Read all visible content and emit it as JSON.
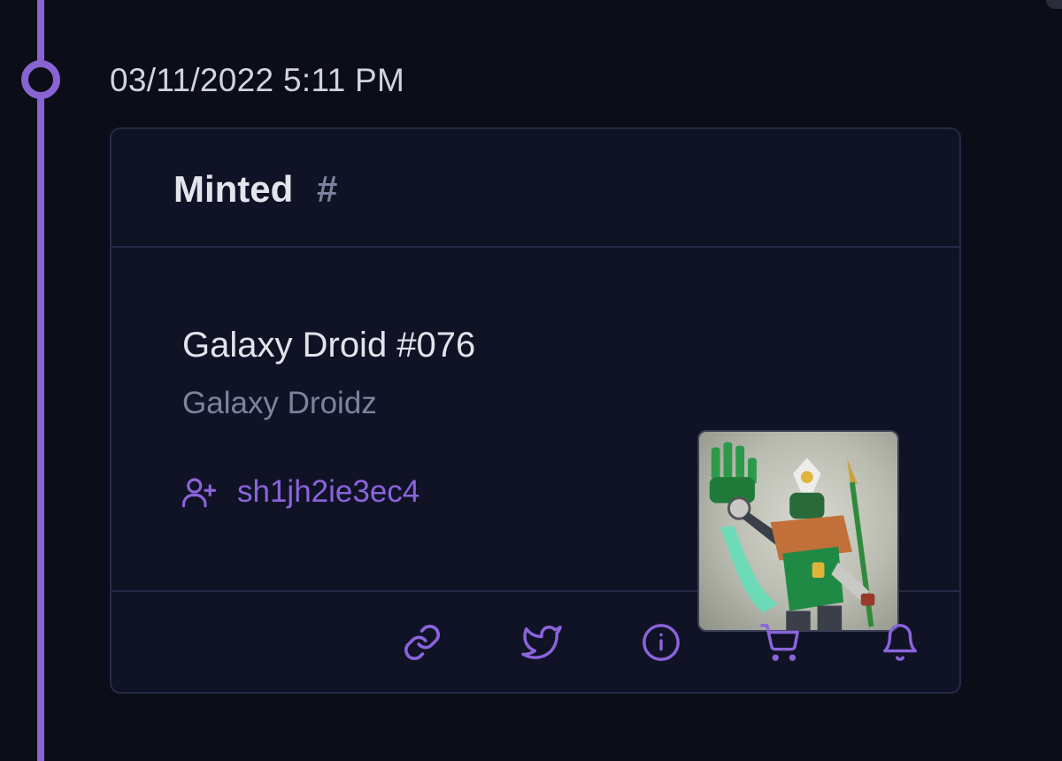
{
  "event": {
    "timestamp": "03/11/2022 5:11 PM",
    "title": "Minted",
    "anchor_symbol": "#"
  },
  "nft": {
    "name": "Galaxy Droid #076",
    "collection": "Galaxy Droidz",
    "minter_address": "sh1jh2ie3ec4",
    "image_alt": "Galaxy Droid #076"
  },
  "actions": [
    {
      "name": "link-icon"
    },
    {
      "name": "twitter-icon"
    },
    {
      "name": "info-icon"
    },
    {
      "name": "cart-icon"
    },
    {
      "name": "bell-icon"
    }
  ],
  "colors": {
    "accent": "#8a63d2",
    "background": "#0b0d18",
    "card": "#101326",
    "border": "#262a44"
  }
}
